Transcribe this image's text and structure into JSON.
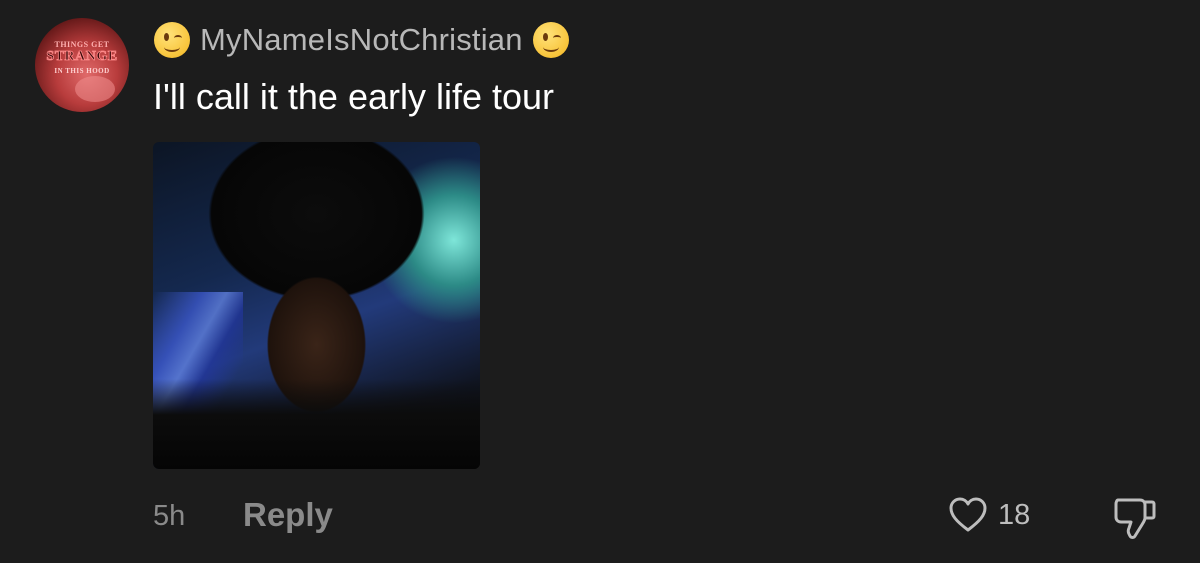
{
  "comment": {
    "username": "MyNameIsNotChristian",
    "username_prefix_emoji": "winking-face",
    "username_suffix_emoji": "winking-face",
    "text": "I'll call it the early life tour",
    "avatar": {
      "line1": "THINGS GET",
      "line2": "STRANGE",
      "line3": "IN THIS HOOD"
    },
    "timestamp": "5h",
    "reply_label": "Reply",
    "like_count": "18",
    "like_icon": "heart-outline-icon",
    "dislike_icon": "thumbs-down-icon"
  },
  "colors": {
    "background": "#1c1c1c",
    "username": "#b8b8b8",
    "meta_text": "#8a8a8a",
    "body_text": "#ffffff"
  }
}
